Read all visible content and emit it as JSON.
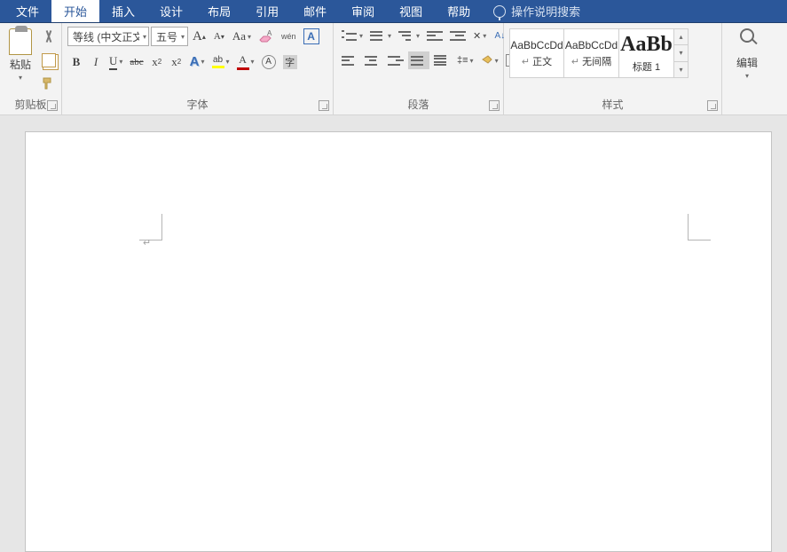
{
  "menubar": {
    "tabs": [
      {
        "label": "文件"
      },
      {
        "label": "开始"
      },
      {
        "label": "插入"
      },
      {
        "label": "设计"
      },
      {
        "label": "布局"
      },
      {
        "label": "引用"
      },
      {
        "label": "邮件"
      },
      {
        "label": "审阅"
      },
      {
        "label": "视图"
      },
      {
        "label": "帮助"
      }
    ],
    "tell_me": "操作说明搜索"
  },
  "ribbon": {
    "clipboard": {
      "label": "剪贴板",
      "paste": "粘贴"
    },
    "font": {
      "label": "字体",
      "font_name": "等线 (中文正文",
      "font_size": "五号",
      "grow_a": "A",
      "shrink_a": "A",
      "aa": "Aa",
      "wen": "wén",
      "boxA": "A",
      "bold": "B",
      "italic": "I",
      "underline": "U",
      "strike": "abc",
      "sub": "x",
      "sup": "x",
      "textfx": "A",
      "highlight": "ab",
      "fontcolor": "A",
      "circledA": "A"
    },
    "paragraph": {
      "label": "段落"
    },
    "styles": {
      "label": "样式",
      "items": [
        {
          "preview": "AaBbCcDd",
          "name": "正文"
        },
        {
          "preview": "AaBbCcDd",
          "name": "无间隔"
        },
        {
          "preview": "AaBb",
          "name": "标题 1"
        }
      ]
    },
    "editing": {
      "label": "编辑"
    }
  },
  "document": {
    "cursor": "↵"
  }
}
